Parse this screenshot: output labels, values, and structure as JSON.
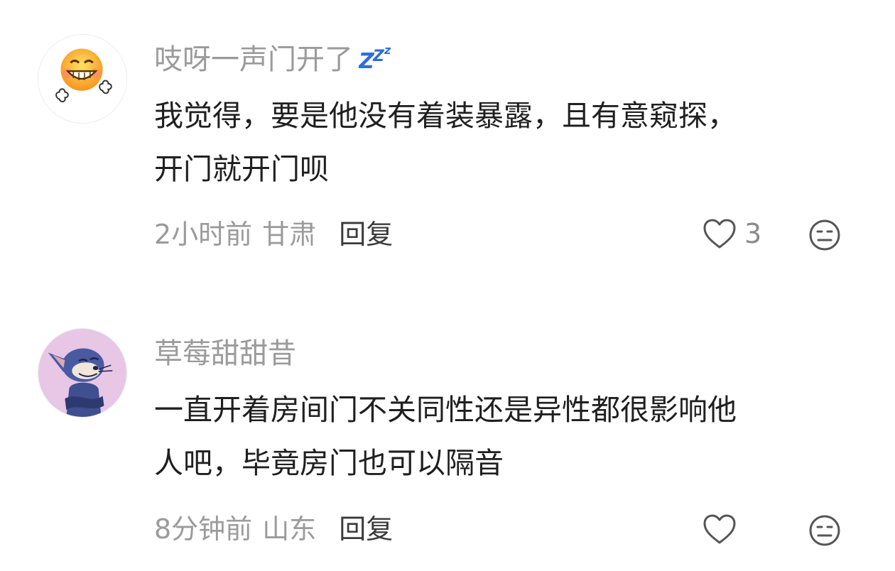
{
  "comments": [
    {
      "username": "吱呀一声门开了",
      "badge_icon": "sleep-zzz-icon",
      "badge_color": "#2f6fd8",
      "avatar": "grinning-emoji-avatar",
      "content_lines": [
        "我觉得，要是他没有着装暴露，且有意窥探，",
        "开门就开门呗"
      ],
      "time": "2小时前",
      "location": "甘肃",
      "reply_label": "回复",
      "like_count": "3"
    },
    {
      "username": "草莓甜甜昔",
      "avatar": "cartoon-cat-avatar",
      "avatar_bg": "#e7c6e6",
      "content_lines": [
        "一直开着房间门不关同性还是异性都很影响他",
        "人吧，毕竟房门也可以隔音"
      ],
      "time": "8分钟前",
      "location": "山东",
      "reply_label": "回复"
    }
  ]
}
